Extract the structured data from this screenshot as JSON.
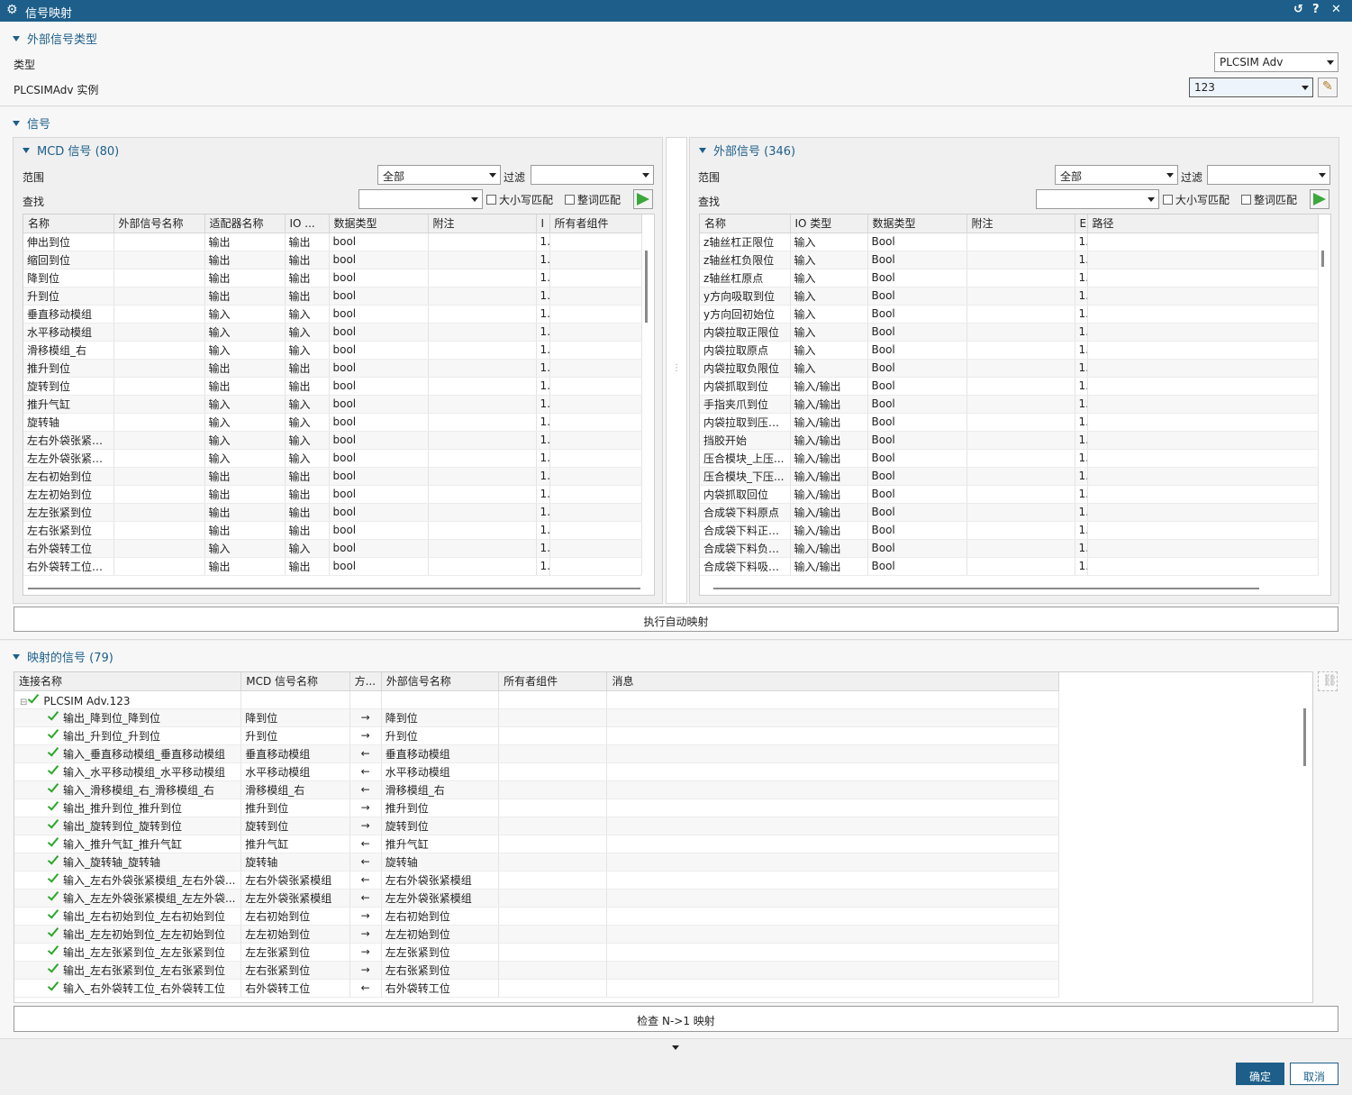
{
  "window": {
    "title": "信号映射"
  },
  "external_type": {
    "header": "外部信号类型",
    "type_label": "类型",
    "type_value": "PLCSIM Adv",
    "instance_label": "PLCSIMAdv 实例",
    "instance_value": "123"
  },
  "signals": {
    "header": "信号",
    "mcd": {
      "header": "MCD 信号 (80)",
      "scope_label": "范围",
      "scope_value": "全部",
      "filter_label": "过滤",
      "filter_value": "",
      "search_label": "查找",
      "search_value": "",
      "case_label": "大小写匹配",
      "word_label": "整词匹配",
      "columns": [
        "名称",
        "外部信号名称",
        "适配器名称",
        "IO ...",
        "数据类型",
        "附注",
        "I",
        "所有者组件"
      ],
      "rows": [
        [
          "伸出到位",
          "",
          "输出",
          "输出",
          "bool",
          "",
          "1",
          ""
        ],
        [
          "缩回到位",
          "",
          "输出",
          "输出",
          "bool",
          "",
          "1",
          ""
        ],
        [
          "降到位",
          "",
          "输出",
          "输出",
          "bool",
          "",
          "1",
          ""
        ],
        [
          "升到位",
          "",
          "输出",
          "输出",
          "bool",
          "",
          "1",
          ""
        ],
        [
          "垂直移动模组",
          "",
          "输入",
          "输入",
          "bool",
          "",
          "1",
          ""
        ],
        [
          "水平移动模组",
          "",
          "输入",
          "输入",
          "bool",
          "",
          "1",
          ""
        ],
        [
          "滑移模组_右",
          "",
          "输入",
          "输入",
          "bool",
          "",
          "1",
          ""
        ],
        [
          "推升到位",
          "",
          "输出",
          "输出",
          "bool",
          "",
          "1",
          ""
        ],
        [
          "旋转到位",
          "",
          "输出",
          "输出",
          "bool",
          "",
          "1",
          ""
        ],
        [
          "推升气缸",
          "",
          "输入",
          "输入",
          "bool",
          "",
          "1",
          ""
        ],
        [
          "旋转轴",
          "",
          "输入",
          "输入",
          "bool",
          "",
          "1",
          ""
        ],
        [
          "左右外袋张紧模...",
          "",
          "输入",
          "输入",
          "bool",
          "",
          "1",
          ""
        ],
        [
          "左左外袋张紧模...",
          "",
          "输入",
          "输入",
          "bool",
          "",
          "1",
          ""
        ],
        [
          "左右初始到位",
          "",
          "输出",
          "输出",
          "bool",
          "",
          "1",
          ""
        ],
        [
          "左左初始到位",
          "",
          "输出",
          "输出",
          "bool",
          "",
          "1",
          ""
        ],
        [
          "左左张紧到位",
          "",
          "输出",
          "输出",
          "bool",
          "",
          "1",
          ""
        ],
        [
          "左右张紧到位",
          "",
          "输出",
          "输出",
          "bool",
          "",
          "1",
          ""
        ],
        [
          "右外袋转工位",
          "",
          "输入",
          "输入",
          "bool",
          "",
          "1",
          ""
        ],
        [
          "右外袋转工位进...",
          "",
          "输出",
          "输出",
          "bool",
          "",
          "1",
          ""
        ]
      ]
    },
    "ext": {
      "header": "外部信号 (346)",
      "scope_label": "范围",
      "scope_value": "全部",
      "filter_label": "过滤",
      "filter_value": "",
      "search_label": "查找",
      "search_value": "",
      "case_label": "大小写匹配",
      "word_label": "整词匹配",
      "columns": [
        "名称",
        "IO 类型",
        "数据类型",
        "附注",
        "E",
        "路径"
      ],
      "rows": [
        [
          "z轴丝杠正限位",
          "输入",
          "Bool",
          "",
          "1",
          ""
        ],
        [
          "z轴丝杠负限位",
          "输入",
          "Bool",
          "",
          "1",
          ""
        ],
        [
          "z轴丝杠原点",
          "输入",
          "Bool",
          "",
          "1",
          ""
        ],
        [
          "y方向吸取到位",
          "输入",
          "Bool",
          "",
          "1",
          ""
        ],
        [
          "y方向回初始位",
          "输入",
          "Bool",
          "",
          "1",
          ""
        ],
        [
          "内袋拉取正限位",
          "输入",
          "Bool",
          "",
          "1",
          ""
        ],
        [
          "内袋拉取原点",
          "输入",
          "Bool",
          "",
          "1",
          ""
        ],
        [
          "内袋拉取负限位",
          "输入",
          "Bool",
          "",
          "1",
          ""
        ],
        [
          "内袋抓取到位",
          "输入/输出",
          "Bool",
          "",
          "1",
          ""
        ],
        [
          "手指夹爪到位",
          "输入/输出",
          "Bool",
          "",
          "1",
          ""
        ],
        [
          "内袋拉取到压合...",
          "输入/输出",
          "Bool",
          "",
          "1",
          ""
        ],
        [
          "挡胶开始",
          "输入/输出",
          "Bool",
          "",
          "1",
          ""
        ],
        [
          "压合模块_上压...",
          "输入/输出",
          "Bool",
          "",
          "1",
          ""
        ],
        [
          "压合模块_下压...",
          "输入/输出",
          "Bool",
          "",
          "1",
          ""
        ],
        [
          "内袋抓取回位",
          "输入/输出",
          "Bool",
          "",
          "1",
          ""
        ],
        [
          "合成袋下料原点",
          "输入/输出",
          "Bool",
          "",
          "1",
          ""
        ],
        [
          "合成袋下料正限...",
          "输入/输出",
          "Bool",
          "",
          "1",
          ""
        ],
        [
          "合成袋下料负限...",
          "输入/输出",
          "Bool",
          "",
          "1",
          ""
        ],
        [
          "合成袋下料吸取...",
          "输入/输出",
          "Bool",
          "",
          "1",
          ""
        ]
      ]
    },
    "auto_map_button": "执行自动映射"
  },
  "mapped": {
    "header": "映射的信号 (79)",
    "columns": [
      "连接名称",
      "MCD 信号名称",
      "方...",
      "外部信号名称",
      "所有者组件",
      "消息"
    ],
    "root": "PLCSIM Adv.123",
    "rows": [
      [
        "输出_降到位_降到位",
        "降到位",
        "→",
        "降到位"
      ],
      [
        "输出_升到位_升到位",
        "升到位",
        "→",
        "升到位"
      ],
      [
        "输入_垂直移动模组_垂直移动模组",
        "垂直移动模组",
        "←",
        "垂直移动模组"
      ],
      [
        "输入_水平移动模组_水平移动模组",
        "水平移动模组",
        "←",
        "水平移动模组"
      ],
      [
        "输入_滑移模组_右_滑移模组_右",
        "滑移模组_右",
        "←",
        "滑移模组_右"
      ],
      [
        "输出_推升到位_推升到位",
        "推升到位",
        "→",
        "推升到位"
      ],
      [
        "输出_旋转到位_旋转到位",
        "旋转到位",
        "→",
        "旋转到位"
      ],
      [
        "输入_推升气缸_推升气缸",
        "推升气缸",
        "←",
        "推升气缸"
      ],
      [
        "输入_旋转轴_旋转轴",
        "旋转轴",
        "←",
        "旋转轴"
      ],
      [
        "输入_左右外袋张紧模组_左右外袋...",
        "左右外袋张紧模组",
        "←",
        "左右外袋张紧模组"
      ],
      [
        "输入_左左外袋张紧模组_左左外袋...",
        "左左外袋张紧模组",
        "←",
        "左左外袋张紧模组"
      ],
      [
        "输出_左右初始到位_左右初始到位",
        "左右初始到位",
        "→",
        "左右初始到位"
      ],
      [
        "输出_左左初始到位_左左初始到位",
        "左左初始到位",
        "→",
        "左左初始到位"
      ],
      [
        "输出_左左张紧到位_左左张紧到位",
        "左左张紧到位",
        "→",
        "左左张紧到位"
      ],
      [
        "输出_左右张紧到位_左右张紧到位",
        "左右张紧到位",
        "→",
        "左右张紧到位"
      ],
      [
        "输入_右外袋转工位_右外袋转工位",
        "右外袋转工位",
        "←",
        "右外袋转工位"
      ]
    ],
    "check_button": "检查 N->1 映射"
  },
  "footer": {
    "ok": "确定",
    "cancel": "取消"
  },
  "colors": {
    "accent": "#1d5f8a",
    "check": "#2aa82a",
    "go": "#3aa83a"
  }
}
